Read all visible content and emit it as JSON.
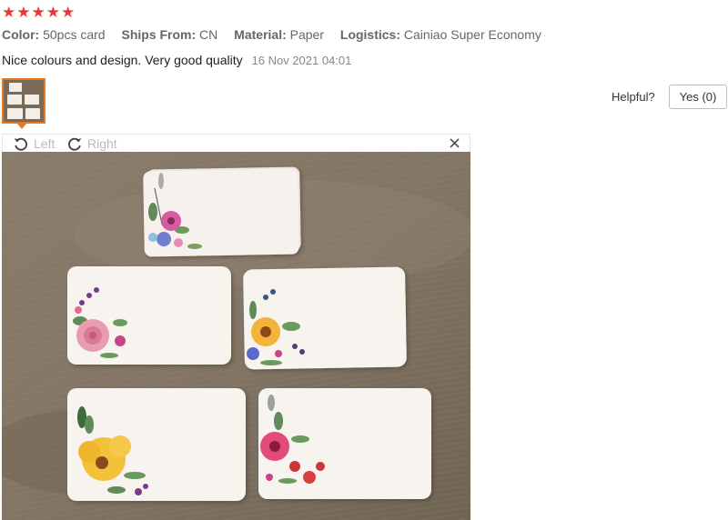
{
  "rating": {
    "stars": [
      "★",
      "★",
      "★",
      "★",
      "★"
    ],
    "color": "#e8383b"
  },
  "attributes": [
    {
      "key": "Color:",
      "value": "50pcs card"
    },
    {
      "key": "Ships From:",
      "value": "CN"
    },
    {
      "key": "Material:",
      "value": "Paper"
    },
    {
      "key": "Logistics:",
      "value": "Cainiao Super Economy"
    }
  ],
  "review": {
    "text": "Nice colours and design. Very good quality",
    "date": "16 Nov 2021 04:01"
  },
  "helpful": {
    "label": "Helpful?",
    "yes_label": "Yes (0)"
  },
  "viewer": {
    "left_label": "Left",
    "right_label": "Right",
    "close_glyph": "×"
  },
  "colors": {
    "accent": "#e07a26"
  }
}
